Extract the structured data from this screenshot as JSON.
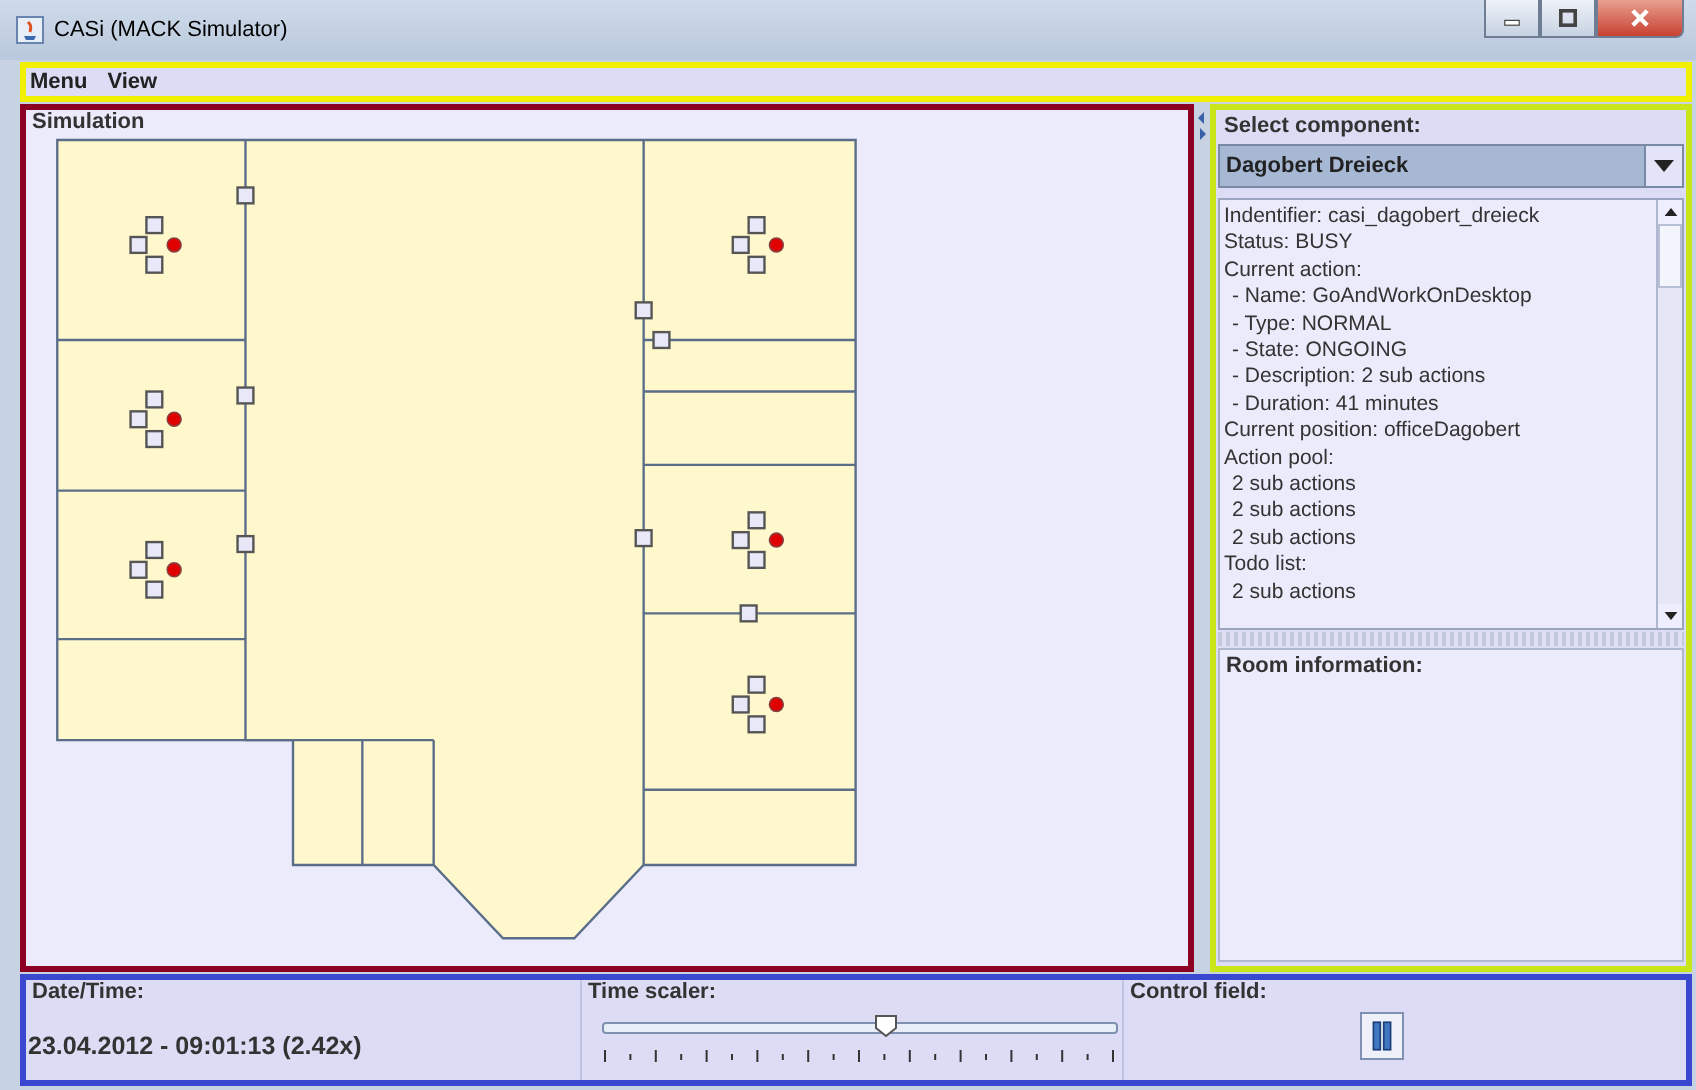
{
  "window": {
    "title": "CASi (MACK Simulator)"
  },
  "menu": [
    {
      "label": "Menu"
    },
    {
      "label": "View"
    }
  ],
  "simulation": {
    "title": "Simulation"
  },
  "component": {
    "title": "Select component:",
    "value": "Dagobert Dreieck",
    "info": [
      {
        "text": "Indentifier: casi_dagobert_dreieck"
      },
      {
        "text": "Status: BUSY"
      },
      {
        "text": "Current action:",
        "children": [
          {
            "text": "- Name: GoAndWorkOnDesktop"
          },
          {
            "text": "- Type: NORMAL"
          },
          {
            "text": "- State: ONGOING"
          },
          {
            "text": "- Description: 2 sub actions"
          },
          {
            "text": "- Duration: 41 minutes"
          }
        ]
      },
      {
        "text": "Current position: officeDagobert"
      },
      {
        "text": "Action pool:",
        "children": [
          {
            "text": "2 sub actions"
          },
          {
            "text": "2 sub actions"
          },
          {
            "text": "2 sub actions"
          }
        ]
      },
      {
        "text": "Todo list:",
        "children": [
          {
            "text": "2 sub actions"
          }
        ]
      }
    ]
  },
  "room": {
    "title": "Room information:"
  },
  "status": {
    "date_label": "Date/Time:",
    "date_value": "23.04.2012 - 09:01:13 (2.42x)",
    "scaler_label": "Time scaler:",
    "scaler": {
      "level": 0.55
    },
    "control_label": "Control field:"
  }
}
